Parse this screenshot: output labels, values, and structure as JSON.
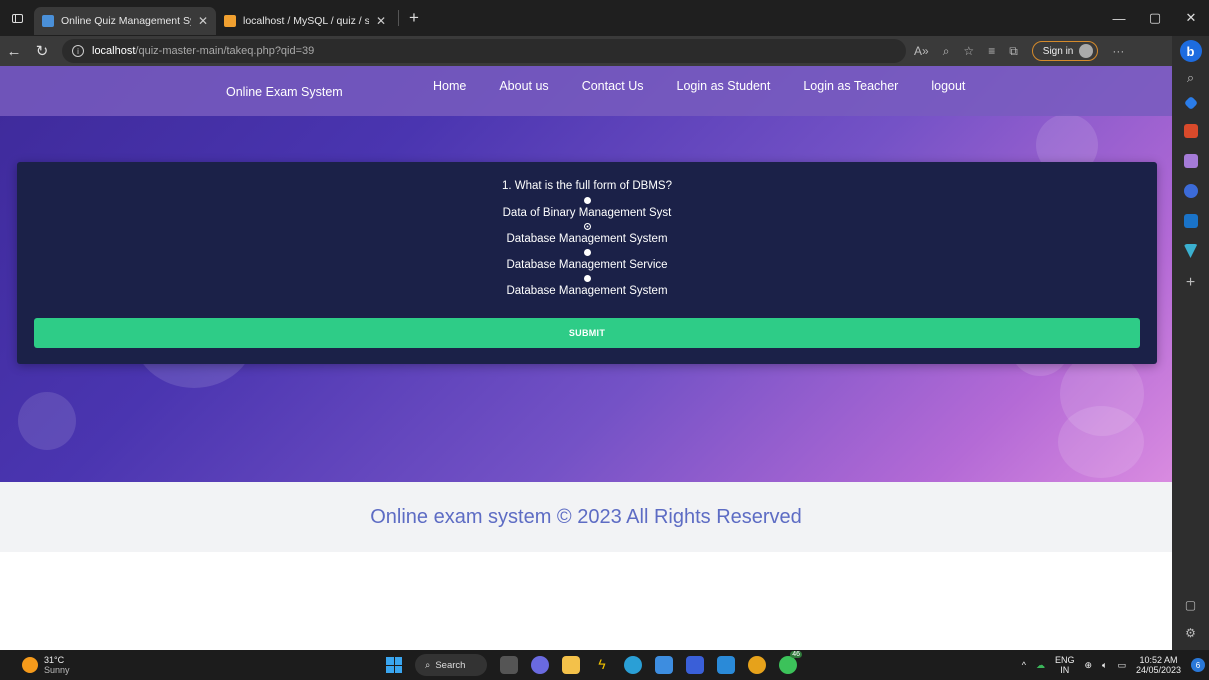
{
  "browser": {
    "tabs": [
      {
        "title": "Online Quiz Management Systen",
        "favicon_color": "#4a90d9",
        "active": true
      },
      {
        "title": "localhost / MySQL / quiz / studer",
        "favicon_color": "#f0a030",
        "active": false
      }
    ],
    "new_tab_glyph": "+",
    "address": {
      "host": "localhost",
      "path": "/quiz-master-main/takeq.php?qid=39"
    },
    "sign_in_label": "Sign in",
    "window_controls": [
      "—",
      "▢",
      "✕"
    ]
  },
  "site": {
    "brand": "Online Exam System",
    "nav": [
      "Home",
      "About us",
      "Contact Us",
      "Login as Student",
      "Login as Teacher",
      "logout"
    ]
  },
  "quiz": {
    "question": "1. What is the full form of DBMS?",
    "options": [
      {
        "label": "Data of Binary Management Syst",
        "checked": false
      },
      {
        "label": "Database Management System",
        "checked": true
      },
      {
        "label": "Database Management Service",
        "checked": false
      },
      {
        "label": "Database Management System",
        "checked": false
      }
    ],
    "submit_label": "SUBMIT"
  },
  "footer": {
    "text": "Online exam system © 2023 All Rights Reserved"
  },
  "taskbar": {
    "weather_temp": "31°C",
    "weather_desc": "Sunny",
    "search_label": "Search",
    "whatsapp_badge": "46",
    "lang_top": "ENG",
    "lang_bottom": "IN",
    "time": "10:52 AM",
    "date": "24/05/2023",
    "notif_count": "6"
  },
  "colors": {
    "accent_submit": "#2ecc87",
    "quiz_card": "#1b2148",
    "footer_text": "#5d6cc4"
  }
}
